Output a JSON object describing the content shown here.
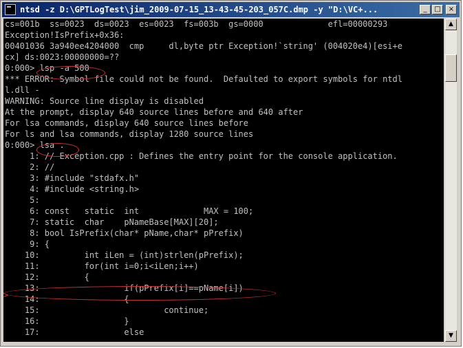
{
  "window": {
    "title": "ntsd -z D:\\GPTLogTest\\jim_2009-07-15_13-43-45-203_057C.dmp -y \"D:\\VC+...",
    "icon": "console-app-icon"
  },
  "title_buttons": {
    "minimize": "_",
    "maximize": "□",
    "close": "×"
  },
  "console_lines": [
    "cs=001b  ss=0023  ds=0023  es=0023  fs=003b  gs=0000             efl=00000293",
    "Exception!IsPrefix+0x36:",
    "00401036 3a940ee4204000  cmp     dl,byte ptr Exception!`string' (004020e4)[esi+e",
    "cx] ds:0023:00000000=??",
    "0:000> lsp -a 500",
    "*** ERROR: Symbol file could not be found.  Defaulted to export symbols for ntdl",
    "l.dll -",
    "WARNING: Source line display is disabled",
    "At the prompt, display 640 source lines before and 640 after",
    "For lsa commands, display 640 source lines before",
    "For ls and lsa commands, display 1280 source lines",
    "0:000> lsa .",
    "     1: // Exception.cpp : Defines the entry point for the console application.",
    "     2: //",
    "     3: #include \"stdafx.h\"",
    "     4: #include <string.h>",
    "     5:",
    "     6: const   static  int             MAX = 100;",
    "     7: static  char    pNameBase[MAX][20];",
    "     8: bool IsPrefix(char* pName,char* pPrefix)",
    "     9: {",
    "    10:         int iLen = (int)strlen(pPrefix);",
    "    11:         for(int i=0;i<iLen;i++)",
    "    12:         {",
    "    13:                 if(pPrefix[i]==pName[i])",
    "    14:                 {",
    "    15:                         continue;",
    "    16:                 }",
    "    17:                 else"
  ],
  "current_line_marker": ">",
  "scrollbar": {
    "up_arrow": "▲",
    "down_arrow": "▼"
  }
}
